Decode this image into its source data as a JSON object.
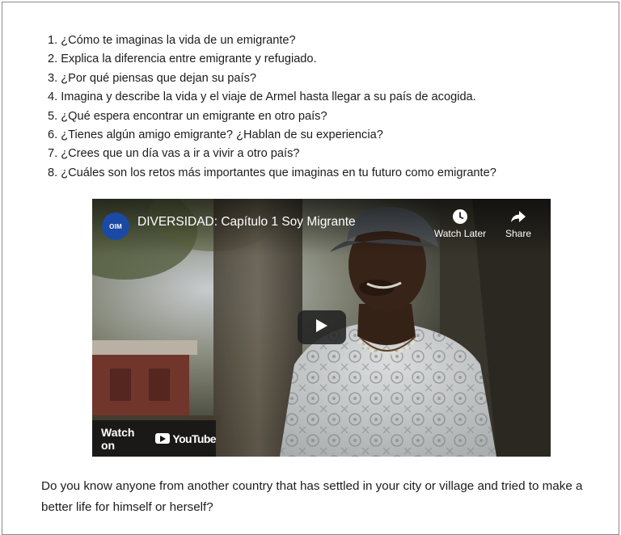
{
  "questions": [
    "1. ¿Cómo te imaginas la vida de un emigrante?",
    "2. Explica la diferencia entre emigrante y refugiado.",
    "3. ¿Por qué piensas que dejan su país?",
    "4. Imagina y describe la vida y el viaje de Armel hasta llegar a su país de acogida.",
    "5. ¿Qué espera encontrar un emigrante en otro país?",
    "6. ¿Tienes algún amigo emigrante? ¿Hablan de su experiencia?",
    "7. ¿Crees que un día vas a ir a vivir a otro país?",
    "8. ¿Cuáles son los retos más importantes que imaginas en tu futuro como emigrante?"
  ],
  "video": {
    "channel_logo_text": "OIM",
    "title": "DIVERSIDAD: Capítulo 1 Soy Migrante",
    "watch_later_label": "Watch Later",
    "share_label": "Share",
    "watch_on_label": "Watch on",
    "youtube_wordmark": "YouTube",
    "play_icon": "play-icon",
    "clock_icon": "clock-icon",
    "share_icon": "share-arrow-icon"
  },
  "bottom_text": "Do you know anyone from another country that has settled in your city or village and tried to make a better life for himself or herself?"
}
